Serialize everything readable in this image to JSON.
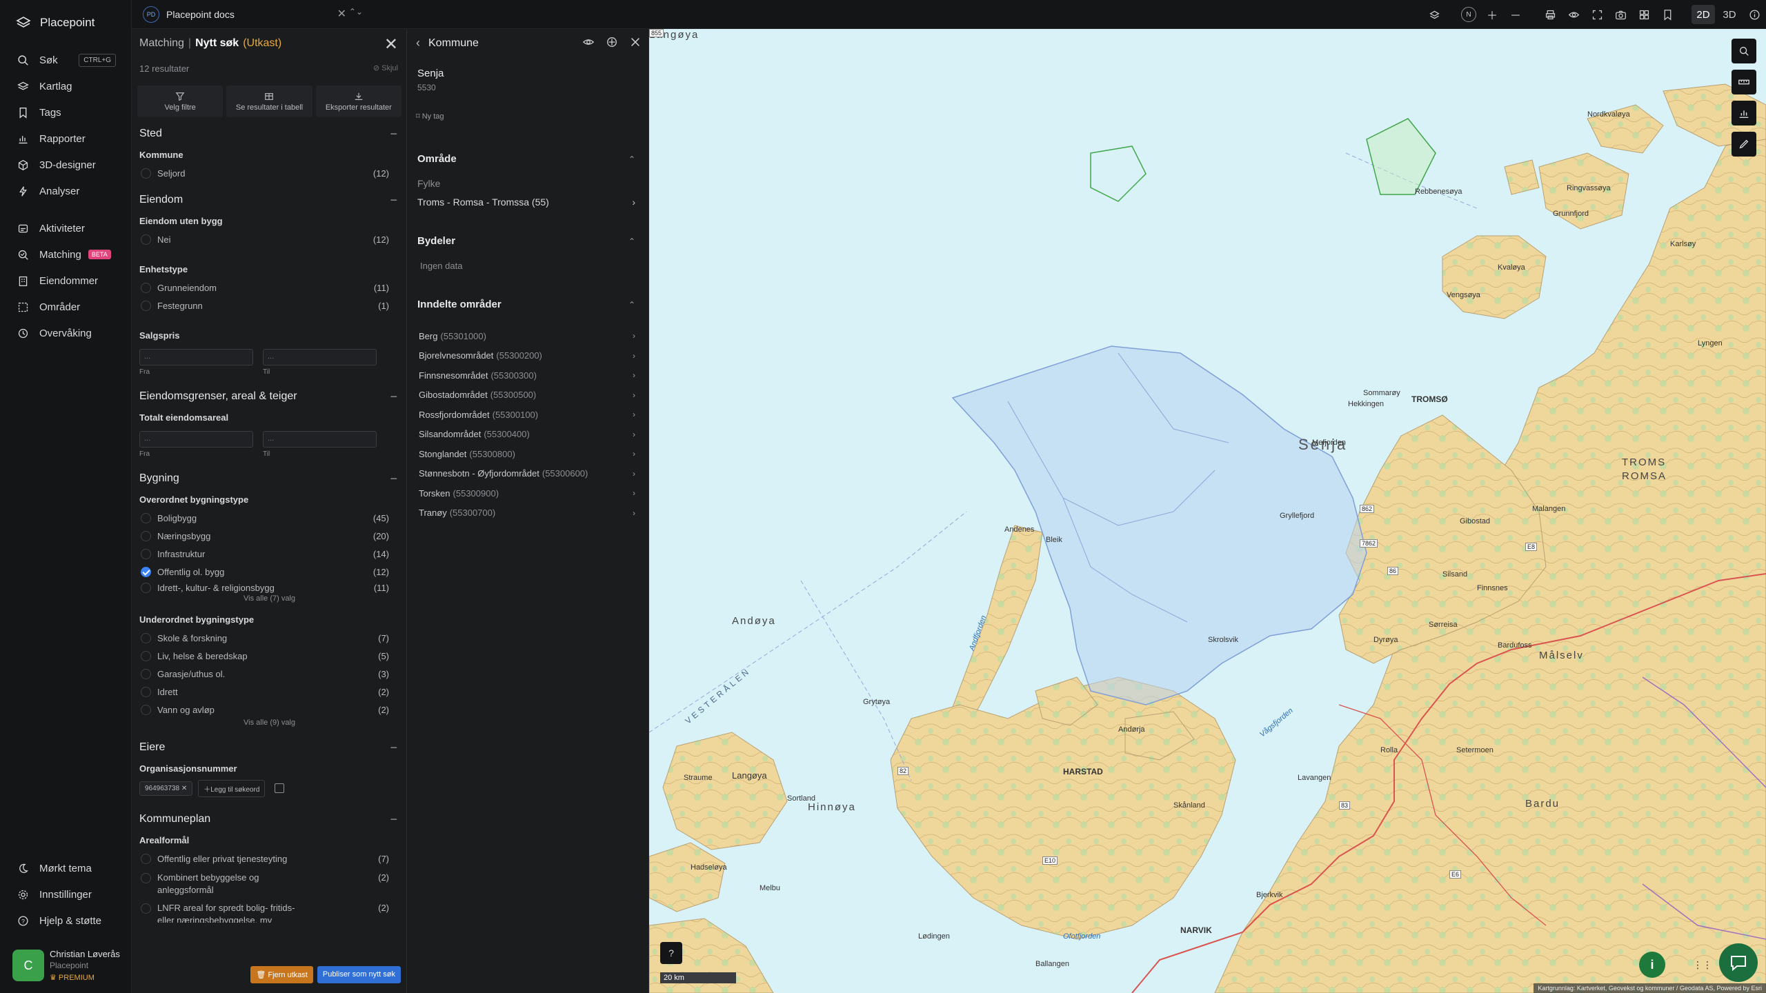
{
  "app": {
    "name": "Placepoint"
  },
  "nav": {
    "items": [
      {
        "label": "Søk",
        "icon": "search-icon",
        "shortcut": "CTRL+G"
      },
      {
        "label": "Kartlag",
        "icon": "layers-icon"
      },
      {
        "label": "Tags",
        "icon": "bookmark-icon"
      },
      {
        "label": "Rapporter",
        "icon": "chart-icon"
      },
      {
        "label": "3D-designer",
        "icon": "cube-icon"
      },
      {
        "label": "Analyser",
        "icon": "bolt-icon"
      },
      {
        "label": "Aktiviteter",
        "icon": "activity-icon"
      },
      {
        "label": "Matching",
        "icon": "match-icon",
        "badge": "BETA"
      },
      {
        "label": "Eiendommer",
        "icon": "building-icon"
      },
      {
        "label": "Områder",
        "icon": "area-icon"
      },
      {
        "label": "Overvåking",
        "icon": "monitor-icon"
      }
    ],
    "bottom": [
      {
        "label": "Mørkt tema",
        "icon": "moon-icon"
      },
      {
        "label": "Innstillinger",
        "icon": "gear-icon"
      },
      {
        "label": "Hjelp & støtte",
        "icon": "help-icon"
      }
    ],
    "user": {
      "initial": "C",
      "name": "Christian Løverås",
      "org": "Placepoint",
      "plan": "PREMIUM"
    }
  },
  "topbar": {
    "doc_badge": "PD",
    "doc_title": "Placepoint docs",
    "north": "N",
    "mode_2d": "2D",
    "mode_3d": "3D"
  },
  "filter": {
    "crumb": "Matching",
    "current": "Nytt søk",
    "draft": "(Utkast)",
    "count": "12 resultater",
    "hide": "Skjul",
    "actions": {
      "filter": "Velg filtre",
      "table": "Se resultater i tabell",
      "export": "Eksporter resultater"
    },
    "sted": {
      "title": "Sted",
      "kommune_label": "Kommune",
      "kommune": {
        "label": "Seljord",
        "count": "(12)"
      }
    },
    "eiendom": {
      "title": "Eiendom",
      "uten_bygg_label": "Eiendom uten bygg",
      "uten_bygg": {
        "label": "Nei",
        "count": "(12)"
      },
      "enhetstype_label": "Enhetstype",
      "enhetstype": [
        {
          "label": "Grunneiendom",
          "count": "(11)"
        },
        {
          "label": "Festegrunn",
          "count": "(1)"
        }
      ],
      "salgspris_label": "Salgspris",
      "from_placeholder": "...",
      "to_placeholder": "...",
      "from_label": "Fra",
      "to_label": "Til"
    },
    "grenser": {
      "title": "Eiendomsgrenser, areal & teiger",
      "areal_label": "Totalt eiendomsareal",
      "from_label": "Fra",
      "to_label": "Til",
      "from_placeholder": "...",
      "to_placeholder": "..."
    },
    "bygning": {
      "title": "Bygning",
      "overordnet_label": "Overordnet bygningstype",
      "overordnet": [
        {
          "label": "Boligbygg",
          "count": "(45)",
          "checked": false
        },
        {
          "label": "Næringsbygg",
          "count": "(20)",
          "checked": false
        },
        {
          "label": "Infrastruktur",
          "count": "(14)",
          "checked": false
        },
        {
          "label": "Offentlig ol. bygg",
          "count": "(12)",
          "checked": true
        },
        {
          "label": "Idrett-, kultur- & religionsbygg",
          "count": "(11)",
          "checked": false
        }
      ],
      "overordnet_viewall": "Vis alle (7) valg",
      "underordnet_label": "Underordnet bygningstype",
      "underordnet": [
        {
          "label": "Skole & forskning",
          "count": "(7)"
        },
        {
          "label": "Liv, helse & beredskap",
          "count": "(5)"
        },
        {
          "label": "Garasje/uthus ol.",
          "count": "(3)"
        },
        {
          "label": "Idrett",
          "count": "(2)"
        },
        {
          "label": "Vann og avløp",
          "count": "(2)"
        }
      ],
      "underordnet_viewall": "Vis alle (9) valg"
    },
    "eiere": {
      "title": "Eiere",
      "org_label": "Organisasjonsnummer",
      "tag": "964963738",
      "add": "Legg til søkeord"
    },
    "kommuneplan": {
      "title": "Kommuneplan",
      "areal_label": "Arealformål",
      "items": [
        {
          "label": "Offentlig eller privat tjenesteyting",
          "count": "(7)"
        },
        {
          "label": "Kombinert bebyggelse og anleggsformål",
          "count": "(2)"
        },
        {
          "label": "LNFR areal for spredt bolig- fritids- eller næringsbebyggelse, mv",
          "count": "(2)"
        }
      ]
    },
    "remove": "Fjern utkast",
    "publish": "Publiser som nytt søk"
  },
  "detail": {
    "title": "Kommune",
    "name": "Senja",
    "code": "5530",
    "new_tag": "Ny tag",
    "omrade": {
      "title": "Område",
      "fylke_label": "Fylke",
      "fylke": "Troms - Romsa - Tromssa (55)"
    },
    "bydeler": {
      "title": "Bydeler",
      "empty": "Ingen data"
    },
    "inndelte": {
      "title": "Inndelte områder",
      "items": [
        {
          "name": "Berg",
          "code": "(55301000)"
        },
        {
          "name": "Bjorelvnesområdet",
          "code": "(55300200)"
        },
        {
          "name": "Finnsnesområdet",
          "code": "(55300300)"
        },
        {
          "name": "Gibostadområdet",
          "code": "(55300500)"
        },
        {
          "name": "Rossfjordområdet",
          "code": "(55300100)"
        },
        {
          "name": "Silsandområdet",
          "code": "(55300400)"
        },
        {
          "name": "Stonglandet",
          "code": "(55300800)"
        },
        {
          "name": "Stønnesbotn - Øyfjordområdet",
          "code": "(55300600)"
        },
        {
          "name": "Torsken",
          "code": "(55300900)"
        },
        {
          "name": "Tranøy",
          "code": "(55300700)"
        }
      ]
    }
  },
  "map": {
    "labels": {
      "senja": "Senja",
      "andoya": "Andøya",
      "troms": "TROMS",
      "romsa": "ROMSA",
      "vesteralen": "VESTERÅLEN",
      "hinnoya": "Hinnøya",
      "langoya": "Langøya",
      "harstad": "HARSTAD",
      "narvik": "NARVIK",
      "tromso": "TROMSØ",
      "malselv": "Målselv",
      "bardu": "Bardu",
      "andenes": "Andenes",
      "kvaloya": "Kvaløya",
      "ringvassoya": "Ringvassøya",
      "dyroya": "Dyrøya",
      "finnsnes": "Finnsnes",
      "silsand": "Silsand",
      "gibostad": "Gibostad",
      "rolla": "Rolla",
      "skrolsvik": "Skrolsvik",
      "hekkingen": "Hekkingen",
      "melfjorden": "Mefjorden",
      "gryllefjord": "Gryllefjord",
      "sommaroy": "Sommarøy",
      "vengsoya": "Vengsøya",
      "karlsoy": "Karlsøy",
      "lyngen": "Lyngen",
      "bjerkvik": "Bjerkvik",
      "andorja": "Andørja",
      "grytoya": "Grytøya",
      "sortland": "Sortland",
      "melbu": "Melbu",
      "lodingen": "Lødingen",
      "ofotfjorden": "Ofotfjorden",
      "malangen": "Malangen",
      "sorreisa": "Sørreisa",
      "bardufoss": "Bardufoss",
      "andfjorden": "Andfjorden",
      "vagsfjorden": "Vågsfjorden",
      "lavangen": "Lavangen",
      "skanland": "Skånland",
      "setermoen": "Setermoen",
      "ballangen": "Ballangen",
      "hadseloya": "Hadseløya",
      "straume": "Straume",
      "bleik": "Bleik",
      "nordkvaloya": "Nordkvaløya",
      "rebbenesøya": "Rebbenesøya",
      "grunnfjord": "Grunnfjord"
    },
    "roads": [
      "E10",
      "E6",
      "E8",
      "82",
      "83",
      "86",
      "862",
      "855",
      "7862"
    ],
    "scale": "20 km",
    "attribution": "Kartgrunnlag: Kartverket, Geovekst og kommuner / Geodata AS, Powered by Esri",
    "colors": {
      "sea": "#d8f2f8",
      "land": "#f0d9a0",
      "forest": "#c8dca0",
      "senja_fill": "#b8d4f0",
      "border": "#d9534f"
    }
  }
}
